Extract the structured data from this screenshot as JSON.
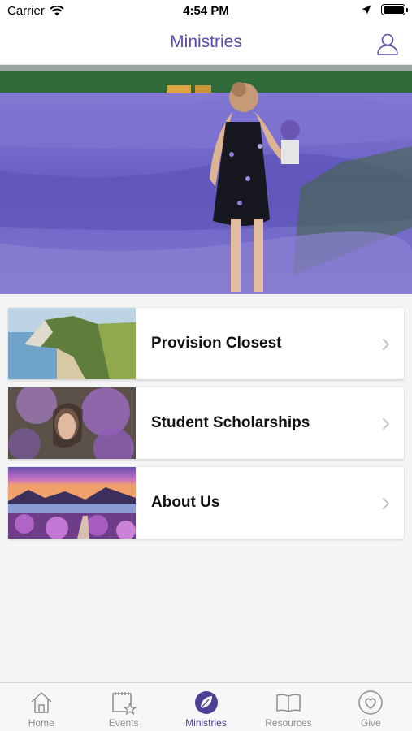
{
  "status_bar": {
    "carrier": "Carrier",
    "time": "4:54 PM"
  },
  "nav": {
    "title": "Ministries"
  },
  "ministries": [
    {
      "label": "Provision Closest"
    },
    {
      "label": "Student Scholarships"
    },
    {
      "label": "About Us"
    }
  ],
  "tabs": [
    {
      "label": "Home",
      "icon": "house-icon"
    },
    {
      "label": "Events",
      "icon": "calendar-star-icon"
    },
    {
      "label": "Ministries",
      "icon": "leaf-icon",
      "active": true
    },
    {
      "label": "Resources",
      "icon": "book-icon"
    },
    {
      "label": "Give",
      "icon": "heart-icon"
    }
  ],
  "colors": {
    "accent": "#5a4aa6",
    "tab_active": "#4d3f94",
    "tab_inactive": "#8e8e93"
  }
}
